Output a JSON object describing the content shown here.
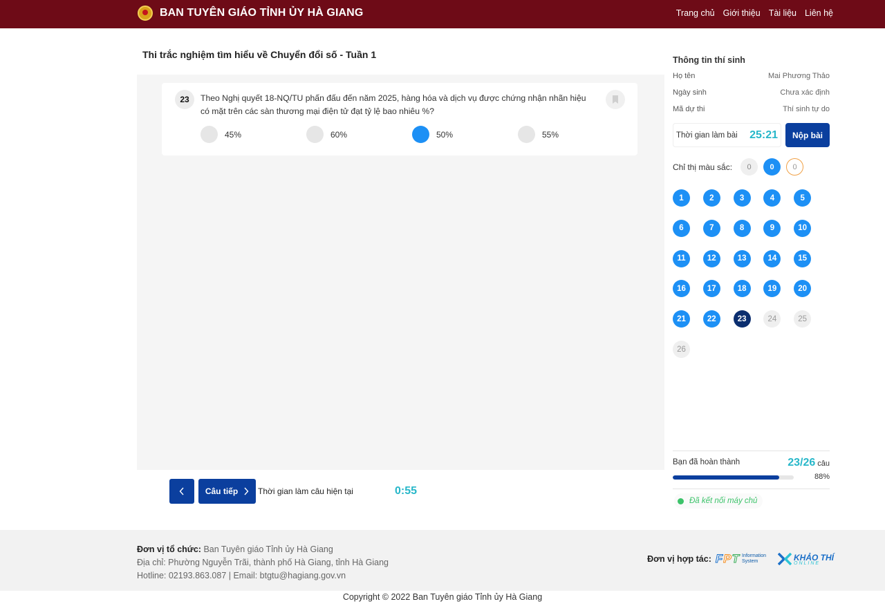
{
  "header": {
    "brand": "BAN TUYÊN GIÁO TỈNH ỦY HÀ GIANG",
    "nav": [
      "Trang chủ",
      "Giới thiệu",
      "Tài liệu",
      "Liên hệ"
    ]
  },
  "exam": {
    "title": "Thi trắc nghiệm tìm hiểu về Chuyển đổi số - Tuần 1",
    "question": {
      "number": "23",
      "text": "Theo Nghị quyết 18-NQ/TU phấn đấu đến năm 2025, hàng hóa và dịch vụ được chứng nhận nhãn hiệu có mặt trên các sàn thương mại điện tử đạt tỷ lệ bao nhiêu %?",
      "options": [
        {
          "label": "45%",
          "selected": false
        },
        {
          "label": "60%",
          "selected": false
        },
        {
          "label": "50%",
          "selected": true
        },
        {
          "label": "55%",
          "selected": false
        }
      ]
    },
    "controls": {
      "next_label": "Câu tiếp",
      "current_time_label": "Thời gian làm câu hiện tại",
      "current_time": "0:55"
    }
  },
  "sidebar": {
    "title": "Thông tin thí sinh",
    "info": [
      {
        "key": "Họ tên",
        "value": "Mai Phương Thảo"
      },
      {
        "key": "Ngày sinh",
        "value": "Chưa xác định"
      },
      {
        "key": "Mã dự thi",
        "value": "Thí sinh tự do"
      }
    ],
    "timer_label": "Thời gian làm bài",
    "timer_value": "25:21",
    "submit_label": "Nộp bài",
    "legend_label": "Chỉ thị màu sắc:",
    "legend": [
      "0",
      "0",
      "0"
    ],
    "questions": [
      {
        "n": "1",
        "state": "answered"
      },
      {
        "n": "2",
        "state": "answered"
      },
      {
        "n": "3",
        "state": "answered"
      },
      {
        "n": "4",
        "state": "answered"
      },
      {
        "n": "5",
        "state": "answered"
      },
      {
        "n": "6",
        "state": "answered"
      },
      {
        "n": "7",
        "state": "answered"
      },
      {
        "n": "8",
        "state": "answered"
      },
      {
        "n": "9",
        "state": "answered"
      },
      {
        "n": "10",
        "state": "answered"
      },
      {
        "n": "11",
        "state": "answered"
      },
      {
        "n": "12",
        "state": "answered"
      },
      {
        "n": "13",
        "state": "answered"
      },
      {
        "n": "14",
        "state": "answered"
      },
      {
        "n": "15",
        "state": "answered"
      },
      {
        "n": "16",
        "state": "answered"
      },
      {
        "n": "17",
        "state": "answered"
      },
      {
        "n": "18",
        "state": "answered"
      },
      {
        "n": "19",
        "state": "answered"
      },
      {
        "n": "20",
        "state": "answered"
      },
      {
        "n": "21",
        "state": "answered"
      },
      {
        "n": "22",
        "state": "answered"
      },
      {
        "n": "23",
        "state": "current"
      },
      {
        "n": "24",
        "state": "unanswered"
      },
      {
        "n": "25",
        "state": "unanswered"
      },
      {
        "n": "26",
        "state": "unanswered"
      }
    ],
    "progress": {
      "label": "Bạn đã hoàn thành",
      "count": "23/26",
      "unit": "câu",
      "percent_text": "88%",
      "fraction": 0.88
    },
    "connection": "Đã kết nối máy chủ"
  },
  "footer": {
    "org_label": "Đơn vị tổ chức:",
    "org_value": "Ban Tuyên giáo Tỉnh ủy Hà Giang",
    "address": "Địa chỉ: Phường Nguyễn Trãi, thành phố Hà Giang, tỉnh Hà Giang",
    "contact": "Hotline: 02193.863.087 | Email: btgtu@hagiang.gov.vn",
    "partner_label": "Đơn vị hợp tác:",
    "fpt_letters": [
      "F",
      "P",
      "T"
    ],
    "fpt_sub": "Information System",
    "kt_title": "KHẢO THÍ",
    "kt_sub": "ONLINE",
    "copyright": "Copyright © 2022 Ban Tuyên giáo Tỉnh ủy Hà Giang"
  },
  "colors": {
    "header_bg": "#6e0b17",
    "primary": "#0b3f9e",
    "answered": "#1d90f5",
    "timer": "#27b7c9"
  },
  "icons": {
    "emblem": "emblem-icon",
    "bookmark": "bookmark-icon",
    "prev": "chevron-left-icon",
    "next": "chevron-right-icon",
    "status": "status-dot-icon"
  }
}
